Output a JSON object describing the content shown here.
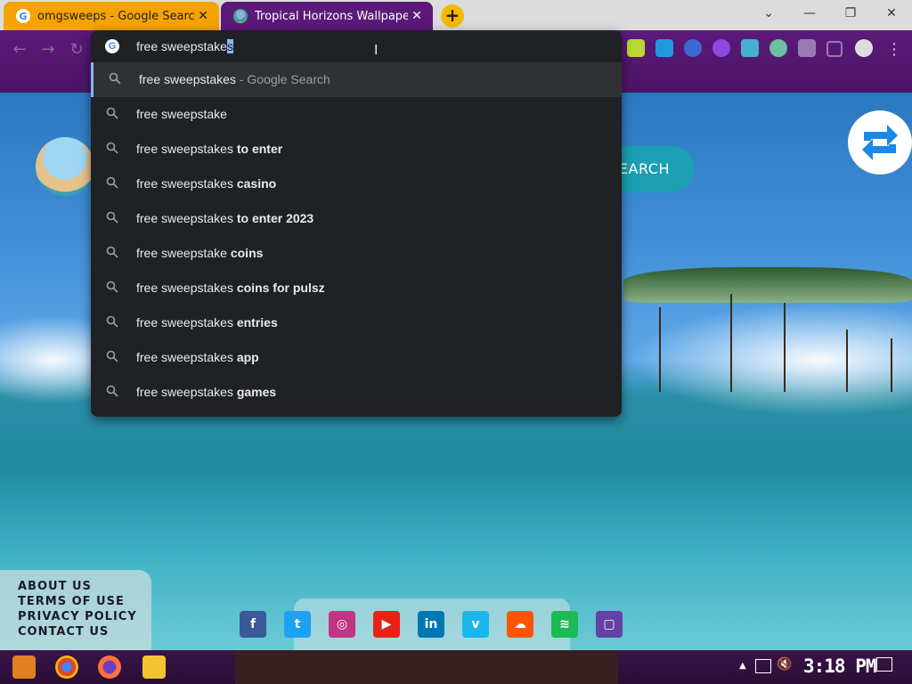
{
  "browser": {
    "tabs": [
      {
        "title": "omgsweeps - Google Search",
        "favicon": "google-icon",
        "active": false,
        "color": "#f5a300"
      },
      {
        "title": "Tropical Horizons Wallpapers",
        "favicon": "tropical-icon",
        "active": true,
        "color": "#5b1a7a"
      }
    ],
    "new_tab_label": "+",
    "window_controls": {
      "minimize": "—",
      "restore": "❐",
      "close": "✕",
      "tab_search": "⌄"
    }
  },
  "omnibox": {
    "typed_text": "free sweepstake",
    "autocomplete_selected": "s",
    "suggestions": [
      {
        "typed": "free sweepstakes",
        "bold": "",
        "hint": " - Google Search",
        "active": true
      },
      {
        "typed": "free sweepstake",
        "bold": "",
        "hint": ""
      },
      {
        "typed": "free sweepstakes",
        "bold": " to enter",
        "hint": ""
      },
      {
        "typed": "free sweepstakes",
        "bold": " casino",
        "hint": ""
      },
      {
        "typed": "free sweepstakes",
        "bold": " to enter 2023",
        "hint": ""
      },
      {
        "typed": "free sweepstake",
        "bold": " coins",
        "hint": ""
      },
      {
        "typed": "free sweepstakes",
        "bold": " coins for pulsz",
        "hint": ""
      },
      {
        "typed": "free sweepstakes",
        "bold": " entries",
        "hint": ""
      },
      {
        "typed": "free sweepstakes",
        "bold": " app",
        "hint": ""
      },
      {
        "typed": "free sweepstakes",
        "bold": " games",
        "hint": ""
      }
    ]
  },
  "page": {
    "search_button_label": "EARCH",
    "footer_links": [
      "ABOUT US",
      "TERMS OF USE",
      "PRIVACY POLICY",
      "CONTACT US"
    ],
    "social_icons": [
      {
        "name": "facebook-icon",
        "glyph": "f",
        "color": "#3b5998"
      },
      {
        "name": "twitter-icon",
        "glyph": "t",
        "color": "#1da1f2"
      },
      {
        "name": "instagram-icon",
        "glyph": "◎",
        "color": "#c13584"
      },
      {
        "name": "youtube-icon",
        "glyph": "▶",
        "color": "#e62117"
      },
      {
        "name": "linkedin-icon",
        "glyph": "in",
        "color": "#0077b5"
      },
      {
        "name": "vimeo-icon",
        "glyph": "v",
        "color": "#1ab7ea"
      },
      {
        "name": "soundcloud-icon",
        "glyph": "☁",
        "color": "#ff5500"
      },
      {
        "name": "spotify-icon",
        "glyph": "≋",
        "color": "#1db954"
      },
      {
        "name": "twitch-icon",
        "glyph": "▢",
        "color": "#6441a5"
      }
    ]
  },
  "taskbar": {
    "clock": "3:18 PM"
  }
}
